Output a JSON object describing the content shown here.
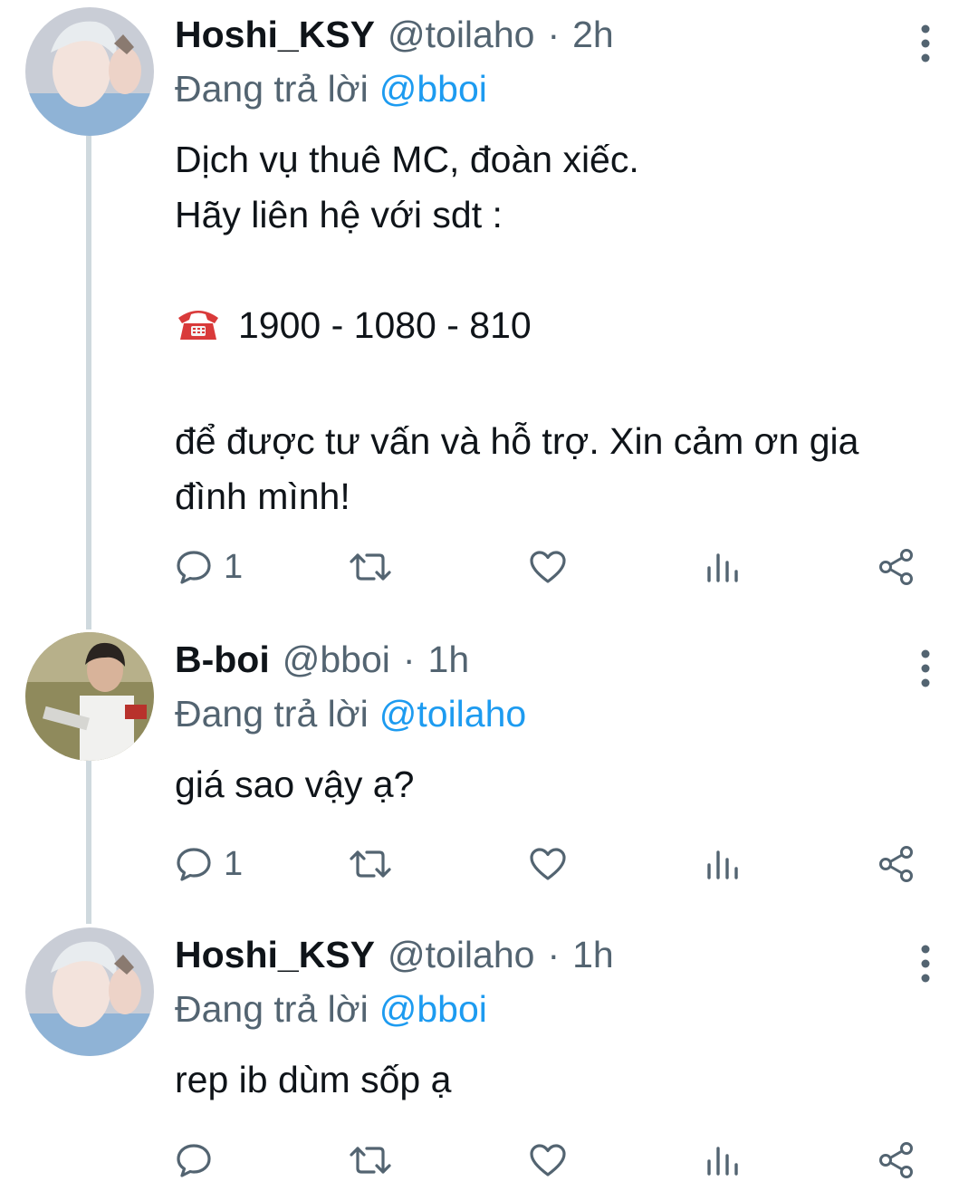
{
  "tweets": [
    {
      "name": "Hoshi_KSY",
      "handle": "@toilaho",
      "dot": "·",
      "time": "2h",
      "replying_prefix": "Đang trả lời",
      "replying_to": "@bboi",
      "lines": [
        "Dịch vụ thuê MC, đoàn xiếc.",
        "Hãy liên hệ với sdt :",
        "",
        "1900 - 1080 - 810",
        "",
        "để được tư vấn và hỗ trợ. Xin cảm ơn gia",
        "đình mình!"
      ],
      "phone_icon": "telephone-icon",
      "reply_count": "1"
    },
    {
      "name": "B-boi",
      "handle": "@bboi",
      "dot": "·",
      "time": "1h",
      "replying_prefix": "Đang trả lời",
      "replying_to": "@toilaho",
      "lines": [
        "giá sao vậy ạ?"
      ],
      "reply_count": "1"
    },
    {
      "name": "Hoshi_KSY",
      "handle": "@toilaho",
      "dot": "·",
      "time": "1h",
      "replying_prefix": "Đang trả lời",
      "replying_to": "@bboi",
      "lines": [
        "rep ib dùm sốp ạ"
      ],
      "reply_count": ""
    }
  ],
  "colors": {
    "text": "#0f1419",
    "secondary": "#536471",
    "mention": "#1d9bf0",
    "thread_line": "#cfd9de"
  },
  "icons": [
    "reply-icon",
    "retweet-icon",
    "like-icon",
    "views-icon",
    "share-icon",
    "more-icon"
  ]
}
